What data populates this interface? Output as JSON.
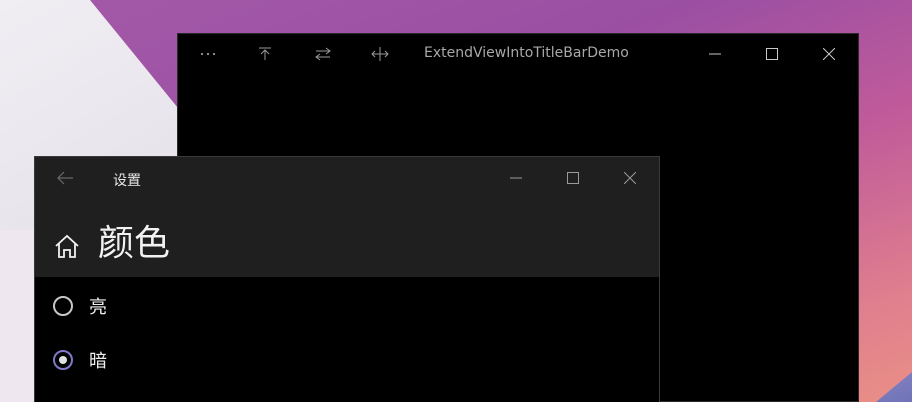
{
  "main_window": {
    "title": "ExtendViewIntoTitleBarDemo",
    "toolbar_icons": [
      "more-icon",
      "arrow-up-to-line-icon",
      "swap-icon",
      "split-icon"
    ]
  },
  "settings_window": {
    "title": "设置",
    "page_title": "颜色",
    "options": [
      {
        "label": "亮",
        "selected": false
      },
      {
        "label": "暗",
        "selected": true
      }
    ]
  },
  "colors": {
    "accent_radio": "#7f78c8",
    "window_background": "#000000",
    "settings_header": "#1f1f1f"
  }
}
